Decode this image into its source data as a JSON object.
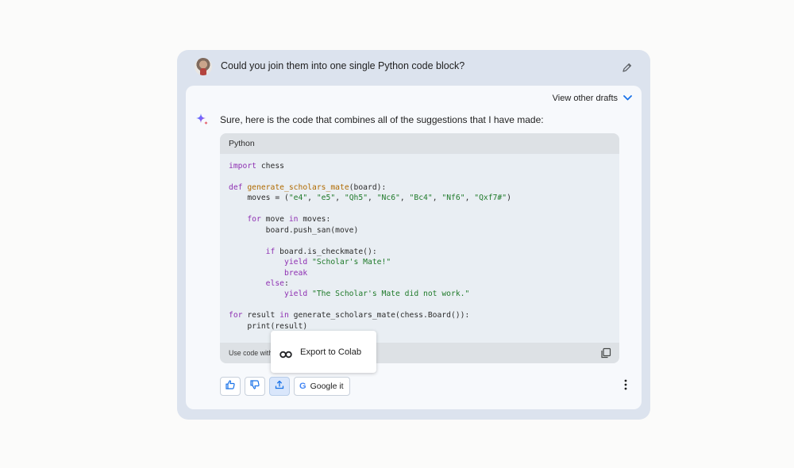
{
  "prompt": {
    "text": "Could you join them into one single Python code block?"
  },
  "drafts": {
    "label": "View other drafts"
  },
  "response": {
    "text": "Sure, here is the code that combines all of the suggestions that I have made:"
  },
  "code": {
    "language": "Python",
    "lines": [
      "import chess",
      "",
      "def generate_scholars_mate(board):",
      "    moves = (\"e4\", \"e5\", \"Qh5\", \"Nc6\", \"Bc4\", \"Nf6\", \"Qxf7#\")",
      "",
      "    for move in moves:",
      "        board.push_san(move)",
      "",
      "        if board.is_checkmate():",
      "            yield \"Scholar's Mate!\"",
      "            break",
      "        else:",
      "            yield \"The Scholar's Mate did not work.\"",
      "",
      "for result in generate_scholars_mate(chess.Board()):",
      "    print(result)"
    ],
    "footer_text": "Use code with"
  },
  "export_menu": {
    "item_label": "Export to Colab"
  },
  "actions": {
    "google_label": "Google it",
    "google_logo": "G"
  },
  "colors": {
    "outer_card": "#dce3ee",
    "inner_card": "#f7f9fc",
    "accent": "#4285f4",
    "keyword": "#8e2fb2",
    "string": "#1f7a2a"
  },
  "icons": {
    "edit": "pencil-icon",
    "drafts": "chevron-down-icon",
    "sparkle": "gemini-sparkle-icon",
    "copy": "copy-icon",
    "colab": "colab-icon",
    "thumbs_up": "thumbs-up-icon",
    "thumbs_down": "thumbs-down-icon",
    "share": "share-icon",
    "more": "more-vertical-icon"
  }
}
